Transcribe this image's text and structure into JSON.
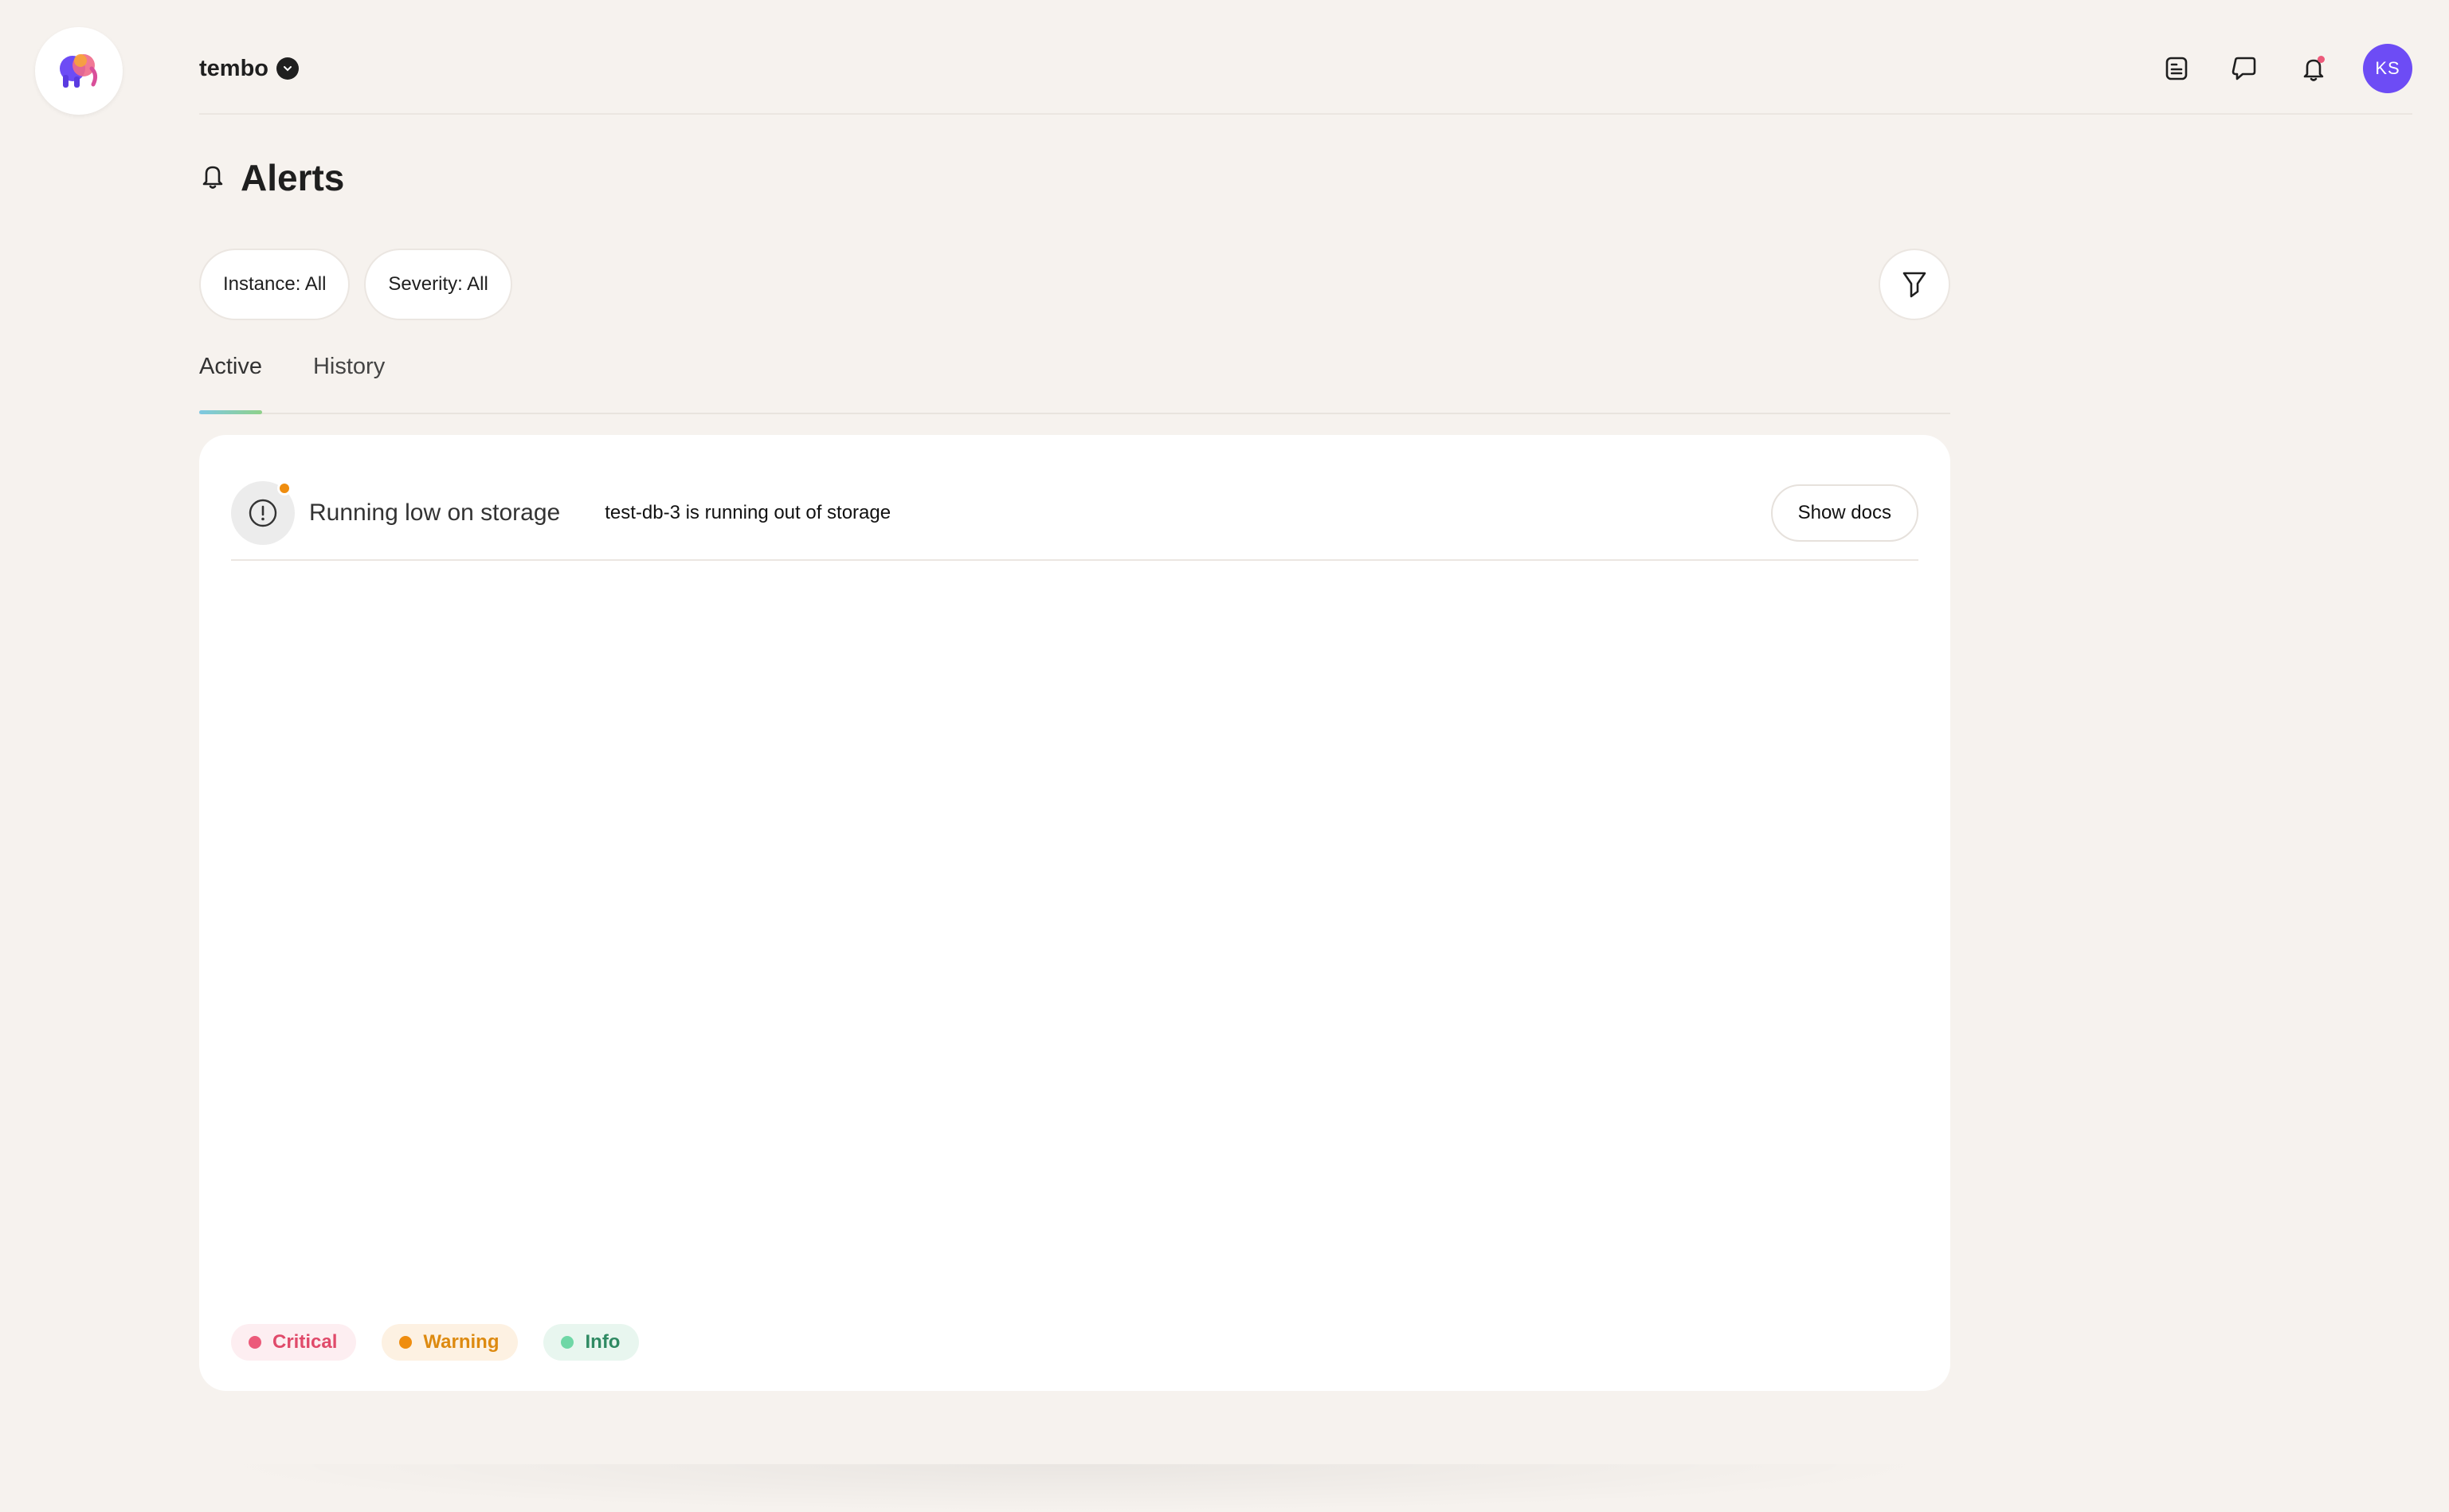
{
  "org": {
    "name": "tembo"
  },
  "user": {
    "initials": "KS",
    "avatar_color": "#6d4cf5"
  },
  "header_icons": [
    "document-icon",
    "chat-icon",
    "bell-icon"
  ],
  "page": {
    "title": "Alerts",
    "icon": "bell-icon"
  },
  "filters": {
    "instance": "Instance: All",
    "severity": "Severity: All"
  },
  "tabs": [
    {
      "label": "Active",
      "active": true
    },
    {
      "label": "History",
      "active": false
    }
  ],
  "alerts": [
    {
      "title": "Running low on storage",
      "description": "test-db-3 is running out of storage",
      "severity": "warning",
      "action_label": "Show docs"
    }
  ],
  "legend": [
    {
      "label": "Critical",
      "color": "#ec5a7a"
    },
    {
      "label": "Warning",
      "color": "#ef8d0f"
    },
    {
      "label": "Info",
      "color": "#6fd7a6"
    }
  ],
  "colors": {
    "background": "#f6f2ee",
    "panel": "#ffffff"
  }
}
